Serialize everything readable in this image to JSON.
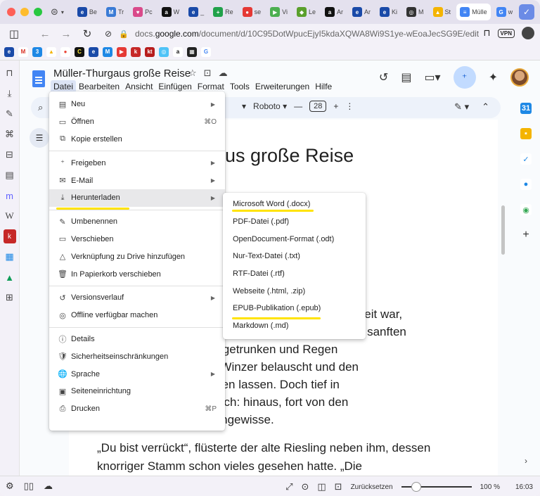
{
  "browser": {
    "tabs": [
      {
        "label": "Be",
        "color": "#1a4aa8",
        "glyph": "e"
      },
      {
        "label": "Tr",
        "color": "#3a7bd5",
        "glyph": "M"
      },
      {
        "label": "Pc",
        "color": "#d94a8a",
        "glyph": "♥"
      },
      {
        "label": "W",
        "color": "#111111",
        "glyph": "a"
      },
      {
        "label": "_",
        "color": "#1a4aa8",
        "glyph": "e"
      },
      {
        "label": "Re",
        "color": "#21a14a",
        "glyph": "+"
      },
      {
        "label": "se",
        "color": "#e53935",
        "glyph": "●"
      },
      {
        "label": "Vi",
        "color": "#4caf50",
        "glyph": "▶"
      },
      {
        "label": "Le",
        "color": "#5aa02c",
        "glyph": "◆"
      },
      {
        "label": "Ar",
        "color": "#111111",
        "glyph": "a"
      },
      {
        "label": "Ar",
        "color": "#1a4aa8",
        "glyph": "e"
      },
      {
        "label": "Ki",
        "color": "#1a4aa8",
        "glyph": "e"
      },
      {
        "label": "M",
        "color": "#333333",
        "glyph": "◎"
      },
      {
        "label": "St",
        "color": "#f4b400",
        "glyph": "▲"
      },
      {
        "label": "Mülle",
        "color": "#4285f4",
        "glyph": "≡"
      },
      {
        "label": "w",
        "color": "#4285f4",
        "glyph": "G"
      }
    ],
    "url_prefix": "docs.",
    "url_domain": "google.com",
    "url_path": "/document/d/10C95DotWpucEjyI5kdaXQWA8Wi9S1ye-wEoaJecSG9E/edit",
    "vpn_label": "VPN"
  },
  "doc": {
    "title": "Müller-Thurgaus große Reise",
    "menus": [
      "Datei",
      "Bearbeiten",
      "Ansicht",
      "Einfügen",
      "Format",
      "Tools",
      "Erweiterungen",
      "Hilfe"
    ],
    "toolbar": {
      "font": "Roboto",
      "size": "28",
      "minus": "—",
      "plus": "+"
    },
    "heading_visible": "us große Reise",
    "body_lines_1": [
      "ndorf",
      "s es Zeit war,",
      "schen sanften",
      "te Sonne getrunken und Regen",
      "che der Winzer belauscht und den",
      "ter rauschen lassen. Doch tief in",
      "ein Wunsch: hinaus, fort von den",
      "ein ins Ungewisse."
    ],
    "body_para_2": "„Du bist verrückt“, flüsterte der alte Riesling neben ihm, dessen knorriger Stamm schon vieles gesehen hatte. „Die"
  },
  "file_menu": {
    "items": [
      {
        "icon": "▤",
        "name": "new",
        "label": "Neu",
        "arrow": true
      },
      {
        "icon": "▭",
        "name": "open",
        "label": "Öffnen",
        "shortcut": "⌘O"
      },
      {
        "icon": "⧉",
        "name": "copy",
        "label": "Kopie erstellen"
      },
      {
        "sep": true
      },
      {
        "icon": "⁺",
        "name": "share",
        "label": "Freigeben",
        "arrow": true
      },
      {
        "icon": "✉",
        "name": "email",
        "label": "E-Mail",
        "arrow": true
      },
      {
        "icon": "⤓",
        "name": "download",
        "label": "Herunterladen",
        "arrow": true,
        "highlighted": true
      },
      {
        "sep": true
      },
      {
        "icon": "✎",
        "name": "rename",
        "label": "Umbenennen"
      },
      {
        "icon": "▭",
        "name": "move",
        "label": "Verschieben"
      },
      {
        "icon": "△",
        "name": "shortcut-drive",
        "label": "Verknüpfung zu Drive hinzufügen"
      },
      {
        "icon": "🗑",
        "name": "trash",
        "label": "In Papierkorb verschieben"
      },
      {
        "sep": true
      },
      {
        "icon": "↺",
        "name": "version-history",
        "label": "Versionsverlauf",
        "arrow": true
      },
      {
        "icon": "◎",
        "name": "offline",
        "label": "Offline verfügbar machen"
      },
      {
        "sep": true
      },
      {
        "icon": "ⓘ",
        "name": "details",
        "label": "Details"
      },
      {
        "icon": "🛡",
        "name": "security",
        "label": "Sicherheitseinschränkungen"
      },
      {
        "icon": "🌐",
        "name": "language",
        "label": "Sprache",
        "arrow": true
      },
      {
        "icon": "▣",
        "name": "page-setup",
        "label": "Seiteneinrichtung"
      },
      {
        "icon": "⎙",
        "name": "print",
        "label": "Drucken",
        "shortcut": "⌘P"
      }
    ]
  },
  "download_submenu": {
    "items": [
      "Microsoft Word (.docx)",
      "PDF-Datei (.pdf)",
      "OpenDocument-Format (.odt)",
      "Nur-Text-Datei (.txt)",
      "RTF-Datei (.rtf)",
      "Webseite (.html, .zip)",
      "EPUB-Publikation (.epub)",
      "Markdown (.md)"
    ]
  },
  "statusbar": {
    "reset_label": "Zurücksetzen",
    "zoom": "100 %",
    "time": "16:03",
    "zoom_level": 0.15
  },
  "highlight_color": "#ffe300"
}
